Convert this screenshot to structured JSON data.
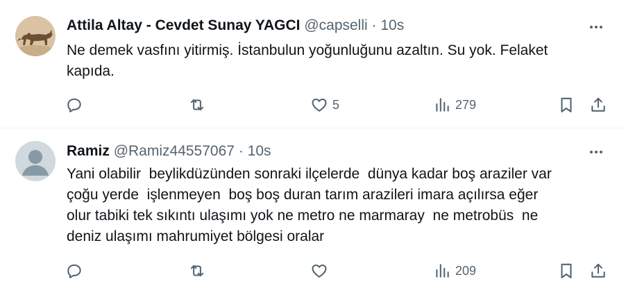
{
  "tweets": [
    {
      "author_name": "Attila Altay - Cevdet Sunay YAGCI",
      "handle": "@capselli",
      "separator": "·",
      "time": "10s",
      "avatar": "wolf-avatar",
      "text_lines": [
        "Ne demek vasfını yitirmiş. İstanbulun yoğunluğunu azaltın. Su yok. Felaket",
        "kapıda."
      ],
      "replies": "",
      "retweets": "",
      "likes": "5",
      "views": "279"
    },
    {
      "author_name": "Ramiz",
      "handle": "@Ramiz44557067",
      "separator": "·",
      "time": "10s",
      "avatar": "default-avatar",
      "text_lines": [
        "Yani olabilir  beylikdüzünden sonraki ilçelerde  dünya kadar boş araziler var",
        "çoğu yerde  işlenmeyen  boş boş duran tarım arazileri imara açılırsa eğer",
        "olur tabiki tek sıkıntı ulaşımı yok ne metro ne marmaray  ne metrobüs  ne",
        "deniz ulaşımı mahrumiyet bölgesi oralar"
      ],
      "replies": "",
      "retweets": "",
      "likes": "",
      "views": "209"
    }
  ],
  "icons": {
    "reply": "reply-icon",
    "retweet": "retweet-icon",
    "like": "heart-icon",
    "views": "views-icon",
    "bookmark": "bookmark-icon",
    "share": "share-icon",
    "more": "more-icon"
  },
  "colors": {
    "text": "#0f1419",
    "secondary": "#536471",
    "divider": "#eff3f4"
  }
}
